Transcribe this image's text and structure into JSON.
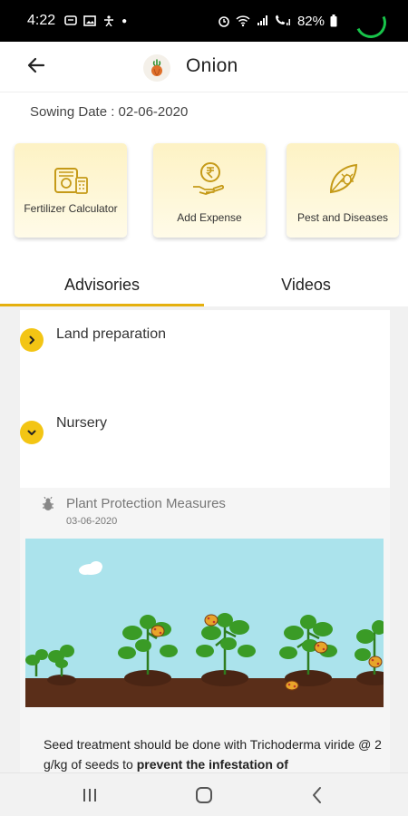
{
  "status_bar": {
    "time": "4:22",
    "battery": "82%",
    "icons_left": [
      "message-icon",
      "gallery-icon",
      "accessibility-icon",
      "dot-icon"
    ],
    "icons_right": [
      "alarm-icon",
      "wifi-icon",
      "signal-icon",
      "call-signal-icon",
      "battery-icon"
    ]
  },
  "app_bar": {
    "title": "Onion",
    "back_icon": "back-arrow-icon",
    "logo_icon": "onion-icon"
  },
  "sowing": {
    "text": "Sowing Date : 02-06-2020"
  },
  "actions": [
    {
      "label": "Fertilizer Calculator",
      "icon": "fertilizer-calculator-icon"
    },
    {
      "label": "Add Expense",
      "icon": "rupee-hand-icon"
    },
    {
      "label": "Pest and Diseases",
      "icon": "pest-leaf-icon"
    }
  ],
  "tabs": [
    {
      "label": "Advisories",
      "active": true
    },
    {
      "label": "Videos",
      "active": false
    }
  ],
  "sections": [
    {
      "label": "Land preparation",
      "expanded": false
    },
    {
      "label": "Nursery",
      "expanded": true
    }
  ],
  "advisory": {
    "title": "Plant Protection Measures",
    "date": "03-06-2020",
    "text_plain": "Seed treatment should be done with Trichoderma viride @ 2 g/kg of seeds to ",
    "text_bold": "prevent the infestation of"
  },
  "colors": {
    "accent": "#F3C514",
    "tab_indicator": "#E5B00E",
    "sky": "#ABE3EC",
    "soil": "#5A2E19",
    "card_bg": "#FDF2C4"
  },
  "nav_bar": {
    "buttons": [
      "recents-icon",
      "home-icon",
      "back-icon"
    ]
  }
}
